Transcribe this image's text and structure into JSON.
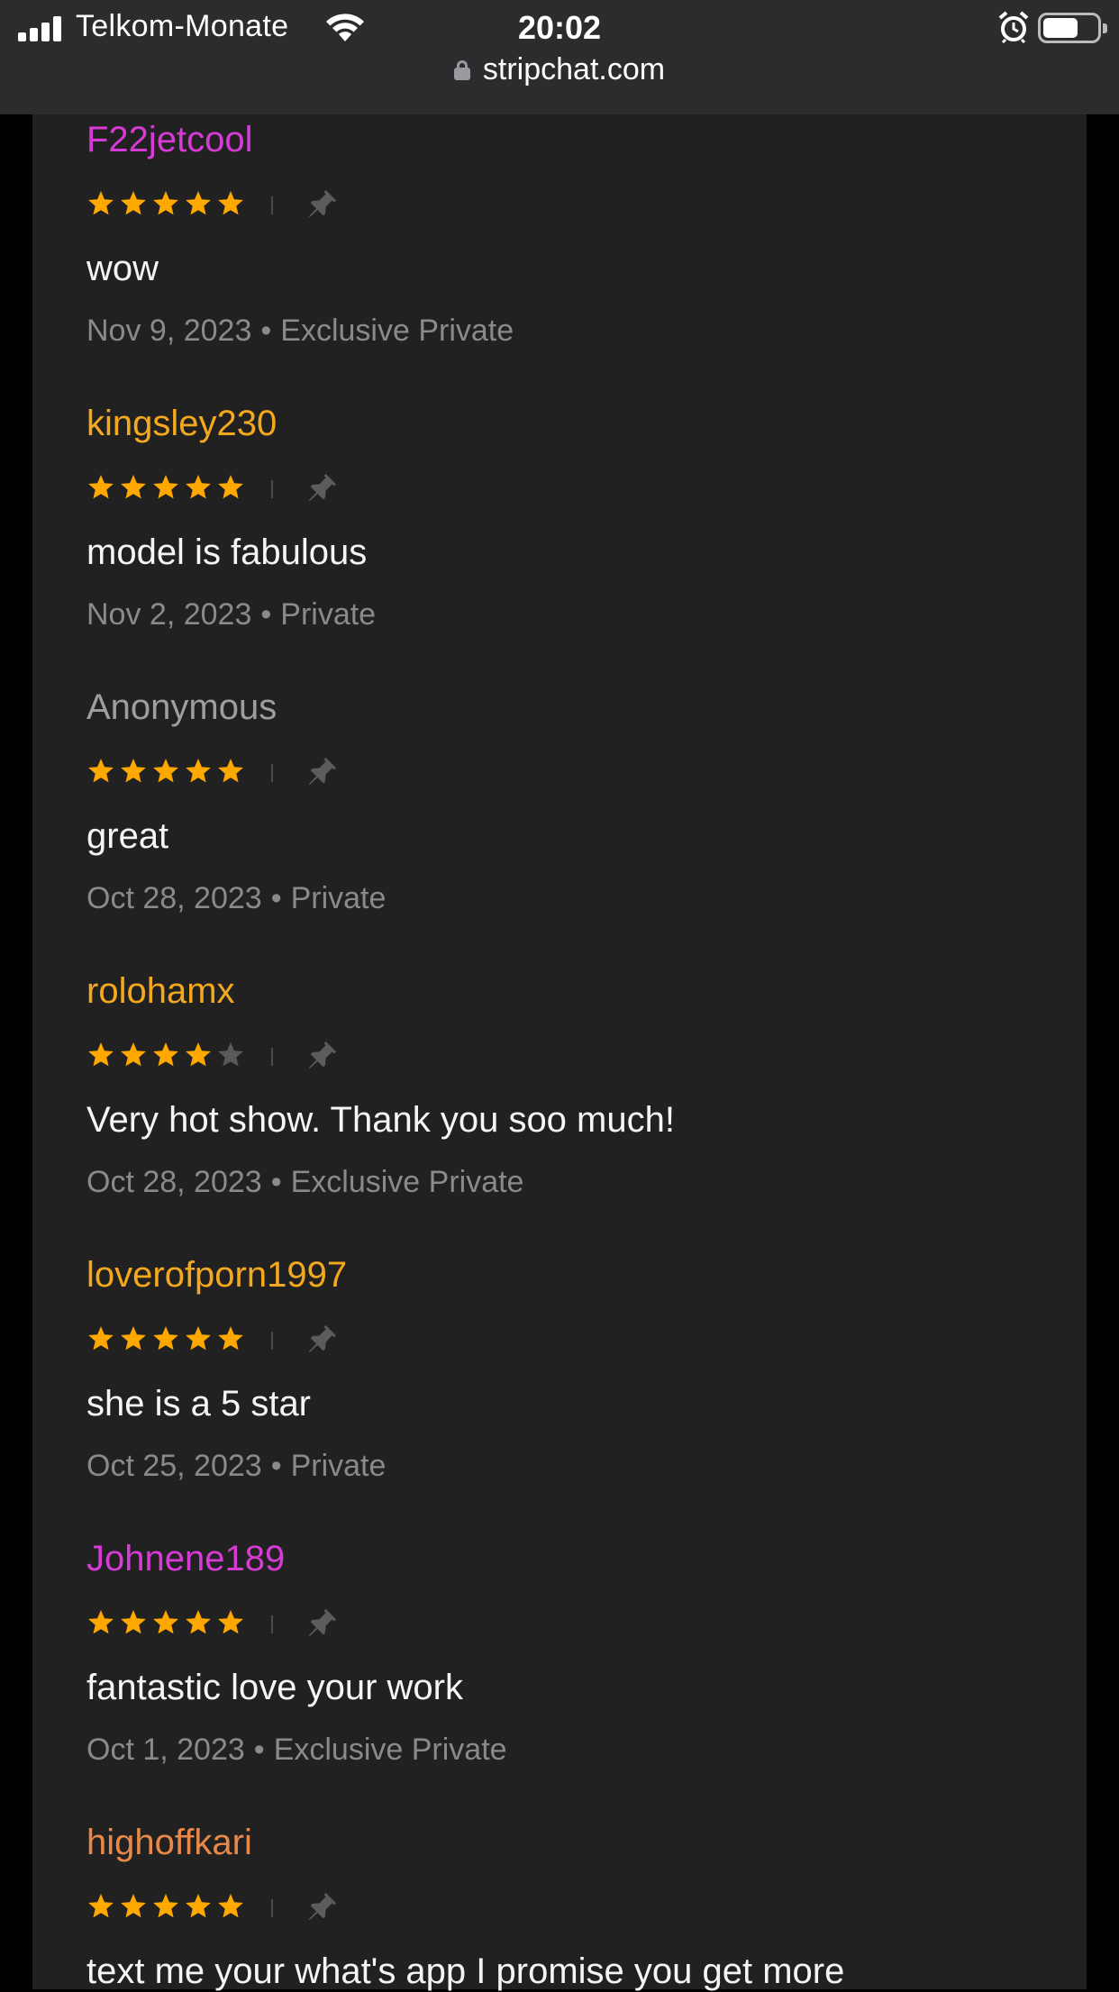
{
  "status_bar": {
    "carrier": "Telkom-Monate",
    "time": "20:02",
    "url": "stripchat.com",
    "battery_level": 0.66
  },
  "colors": {
    "star_filled": "#ffa800",
    "star_empty": "#5a5a5a",
    "user_purple": "#d63bd6",
    "user_gold": "#f4a81d",
    "user_gray": "#9e9e9e",
    "user_orange": "#e8894a"
  },
  "reviews": [
    {
      "username": "F22jetcool",
      "username_color": "#d63bd6",
      "rating": 5,
      "comment": "wow",
      "date": "Nov 9, 2023",
      "type": "Exclusive Private"
    },
    {
      "username": "kingsley230",
      "username_color": "#f4a81d",
      "rating": 5,
      "comment": "model is fabulous",
      "date": "Nov 2, 2023",
      "type": "Private"
    },
    {
      "username": "Anonymous",
      "username_color": "#9e9e9e",
      "rating": 5,
      "comment": "great",
      "date": "Oct 28, 2023",
      "type": "Private"
    },
    {
      "username": "rolohamx",
      "username_color": "#f4a81d",
      "rating": 4,
      "comment": "Very hot show. Thank you soo much!",
      "date": "Oct 28, 2023",
      "type": "Exclusive Private"
    },
    {
      "username": "loverofporn1997",
      "username_color": "#f4a81d",
      "rating": 5,
      "comment": "she is a 5 star",
      "date": "Oct 25, 2023",
      "type": "Private"
    },
    {
      "username": "Johnene189",
      "username_color": "#d63bd6",
      "rating": 5,
      "comment": "fantastic love your work",
      "date": "Oct 1, 2023",
      "type": "Exclusive Private"
    },
    {
      "username": "highoffkari",
      "username_color": "#e8894a",
      "rating": 5,
      "comment": "text me your what's app I promise you get more",
      "date": "",
      "type": ""
    }
  ],
  "separator": "•"
}
